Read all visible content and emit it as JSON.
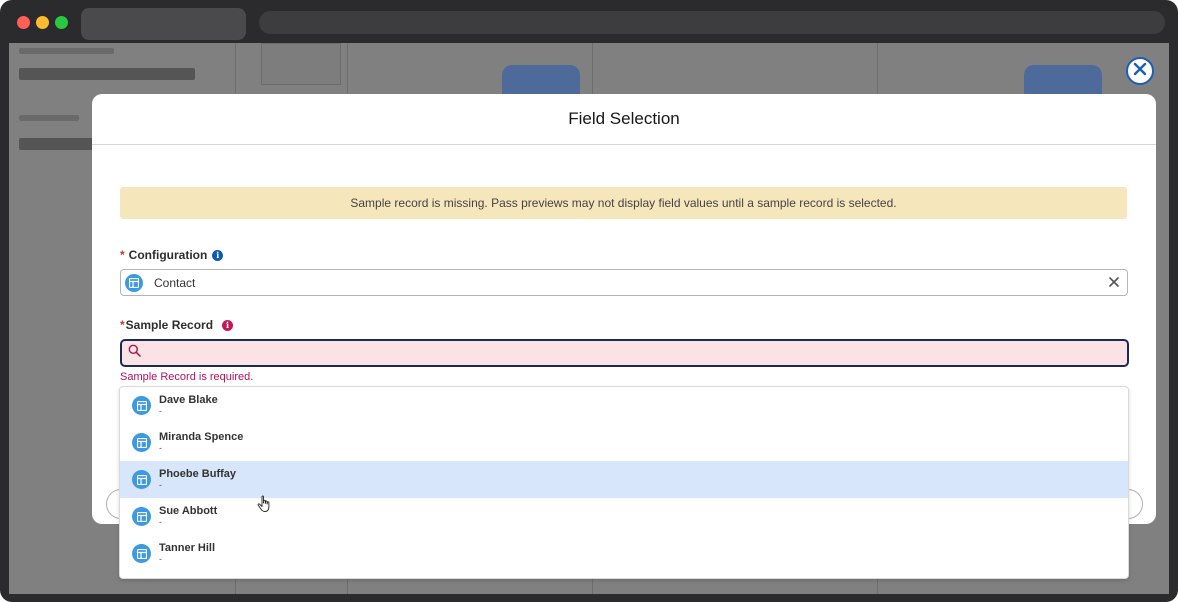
{
  "modal": {
    "title": "Field Selection",
    "warning": "Sample record is missing. Pass previews may not display field values until a sample record is selected."
  },
  "configuration": {
    "required_mark": "*",
    "label": "Configuration",
    "info_icon": "info-icon",
    "value": "Contact",
    "clear_icon": "close-icon"
  },
  "sample_record": {
    "required_mark": "*",
    "label": "Sample Record",
    "info_icon": "info-icon",
    "search_value": "",
    "error": "Sample Record is required."
  },
  "dropdown": {
    "items": [
      {
        "name": "Dave Blake",
        "sub": "-"
      },
      {
        "name": "Miranda Spence",
        "sub": "-"
      },
      {
        "name": "Phoebe Buffay",
        "sub": "-",
        "hovered": true
      },
      {
        "name": "Sue Abbott",
        "sub": "-"
      },
      {
        "name": "Tanner Hill",
        "sub": "-"
      }
    ]
  },
  "colors": {
    "accent": "#1b5fb4",
    "error": "#b4115d",
    "warning_bg": "#f6e6bc",
    "hover_bg": "#d7e6fa",
    "icon_bg": "#3b9ae1"
  }
}
